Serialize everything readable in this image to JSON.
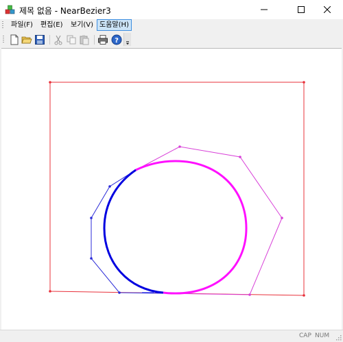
{
  "window": {
    "title": "제목 없음 - NearBezier3",
    "icon": "app-cubes-icon"
  },
  "window_controls": [
    "minimize-icon",
    "maximize-icon",
    "close-icon"
  ],
  "menu": {
    "items": [
      {
        "label": "파일(F)"
      },
      {
        "label": "편집(E)"
      },
      {
        "label": "보기(V)"
      },
      {
        "label": "도움말(H)",
        "highlighted": true
      }
    ]
  },
  "toolbar": {
    "buttons": [
      "new-file-icon",
      "open-folder-icon",
      "save-disk-icon",
      "cut-icon",
      "copy-icon",
      "paste-icon",
      "print-icon",
      "help-icon"
    ]
  },
  "status": {
    "cap": "CAP",
    "num": "NUM"
  },
  "colors": {
    "frame": "#e8303a",
    "control_polygon_blue": "#2a2ad8",
    "control_polygon_magenta": "#d840d8",
    "curve_blue": "#0000e0",
    "curve_magenta": "#ff10ff"
  }
}
